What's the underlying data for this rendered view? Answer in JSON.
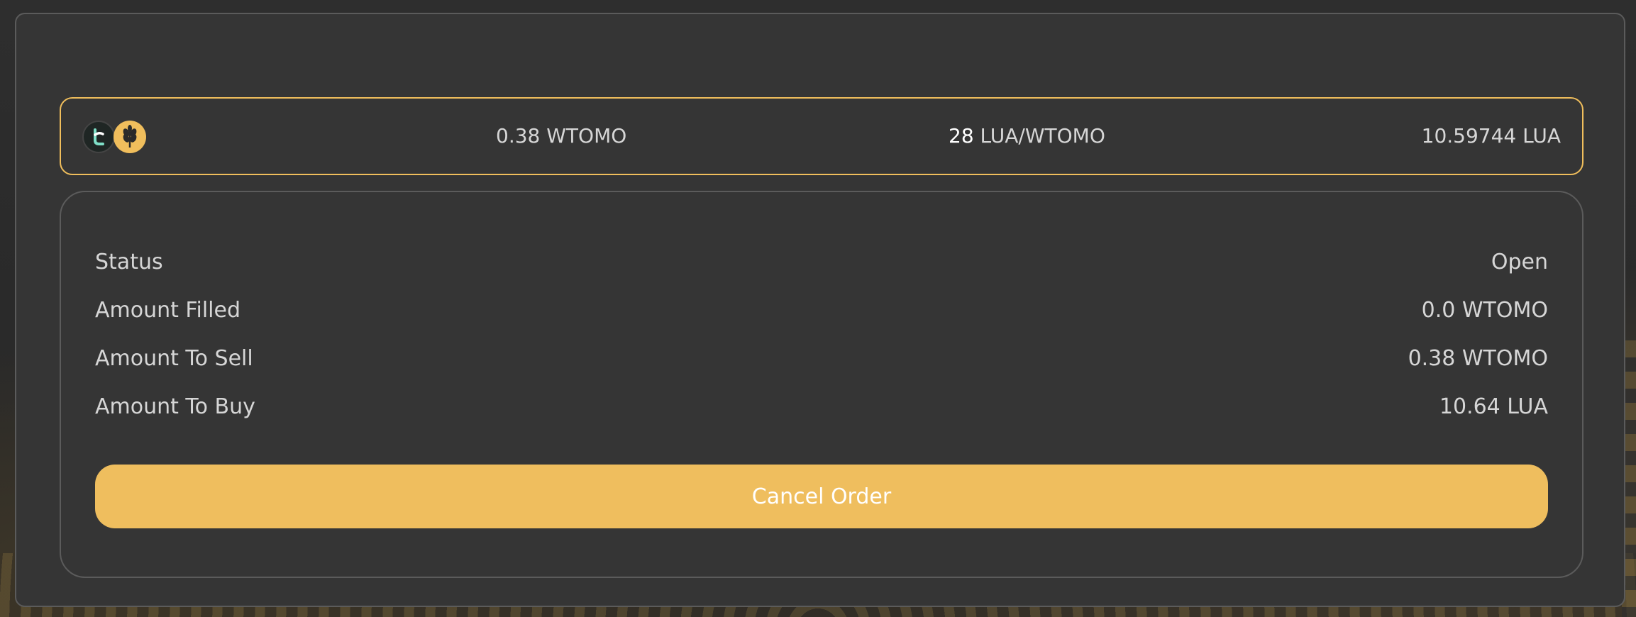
{
  "order": {
    "sell_amount": "0.38",
    "sell_token": "WTOMO",
    "price_value": "28",
    "price_unit_quote": "LUA",
    "price_separator": "/",
    "price_unit_base": "WTOMO",
    "buy_amount": "10.59744",
    "buy_token": "LUA"
  },
  "icons": {
    "token_a": "tomo-token-icon",
    "token_b": "lua-wheat-token-icon"
  },
  "details": [
    {
      "label": "Status",
      "value": "Open"
    },
    {
      "label": "Amount Filled",
      "value": "0.0 WTOMO"
    },
    {
      "label": "Amount To Sell",
      "value": "0.38 WTOMO"
    },
    {
      "label": "Amount To Buy",
      "value": "10.64 LUA"
    }
  ],
  "actions": {
    "cancel_label": "Cancel Order"
  },
  "colors": {
    "accent": "#efbe5e",
    "panel": "#353535",
    "border": "#5b5b5b",
    "text": "#d6d6d6"
  }
}
